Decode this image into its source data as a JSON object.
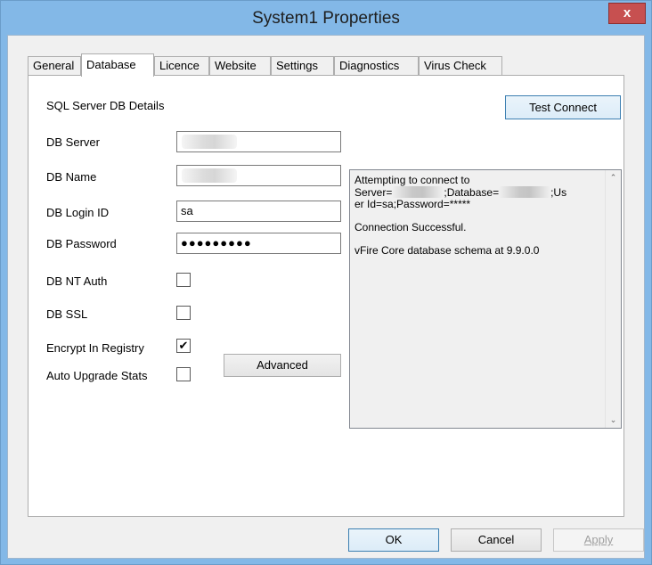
{
  "window": {
    "title": "System1 Properties",
    "close_glyph": "x"
  },
  "tabs": [
    {
      "label": "General",
      "active": false
    },
    {
      "label": "Database",
      "active": true
    },
    {
      "label": "Licence",
      "active": false
    },
    {
      "label": "Website",
      "active": false
    },
    {
      "label": "Settings",
      "active": false
    },
    {
      "label": "Diagnostics",
      "active": false
    },
    {
      "label": "Virus Check",
      "active": false
    }
  ],
  "database": {
    "section_title": "SQL Server DB Details",
    "test_connect_label": "Test Connect",
    "advanced_label": "Advanced",
    "fields": {
      "server_label": "DB Server",
      "server_value": "",
      "name_label": "DB Name",
      "name_value": "",
      "login_label": "DB Login ID",
      "login_value": "sa",
      "password_label": "DB Password",
      "password_value": "●●●●●●●●●"
    },
    "checkboxes": {
      "nt_auth_label": "DB NT Auth",
      "nt_auth_checked": false,
      "ssl_label": "DB SSL",
      "ssl_checked": false,
      "encrypt_label": "Encrypt In Registry",
      "encrypt_checked": true,
      "auto_upgrade_label": "Auto Upgrade Stats",
      "auto_upgrade_checked": false
    },
    "log": {
      "line1": "Attempting to connect to",
      "line2a": "Server=",
      "line2b": ";Database=",
      "line2c": ";Us",
      "line3": "er Id=sa;Password=*****",
      "line4": "Connection Successful.",
      "line5": "vFire Core database schema at 9.9.0.0"
    }
  },
  "footer": {
    "ok_label": "OK",
    "cancel_label": "Cancel",
    "apply_label": "Apply"
  },
  "icons": {
    "check": "✔",
    "scroll_up": "⌃",
    "scroll_down": "⌄"
  }
}
